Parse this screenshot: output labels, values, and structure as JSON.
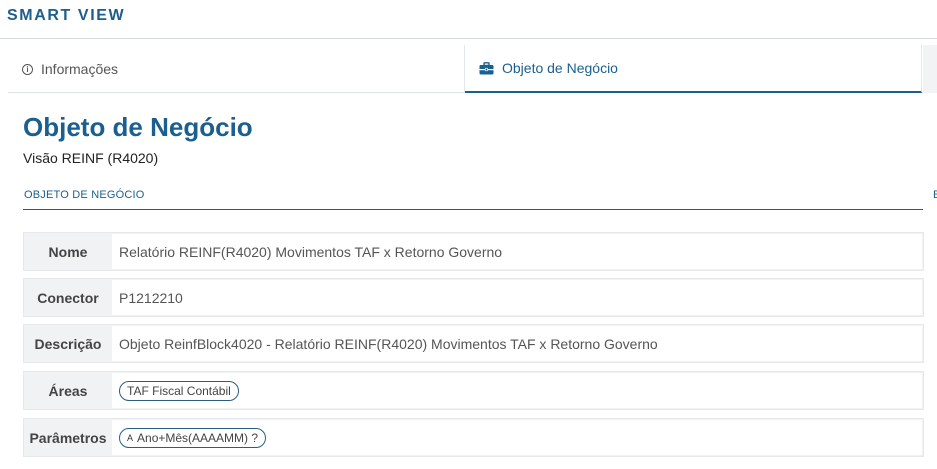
{
  "app": {
    "title": "SMART VIEW"
  },
  "tabs": [
    {
      "label": "Informações",
      "icon": "info-icon",
      "active": false
    },
    {
      "label": "Objeto de Negócio",
      "icon": "briefcase-icon",
      "active": true
    }
  ],
  "main": {
    "title": "Objeto de Negócio",
    "subtitle": "Visão REINF (R4020)",
    "section_label": "OBJETO DE NEGÓCIO",
    "edge_letter": "E"
  },
  "fields": {
    "nome": {
      "label": "Nome",
      "value": "Relatório REINF(R4020) Movimentos TAF x Retorno Governo"
    },
    "conector": {
      "label": "Conector",
      "value": "P1212210"
    },
    "descricao": {
      "label": "Descrição",
      "value": "Objeto ReinfBlock4020 - Relatório REINF(R4020) Movimentos TAF x Retorno Governo"
    },
    "areas": {
      "label": "Áreas",
      "chips": [
        "TAF Fiscal Contábil"
      ]
    },
    "parametros": {
      "label": "Parâmetros",
      "chips": [
        {
          "glyph": "A",
          "text": "Ano+Mês(AAAAMM) ?"
        }
      ]
    }
  },
  "colors": {
    "accent": "#1b5f8f",
    "chip_border": "#2b5d82"
  }
}
